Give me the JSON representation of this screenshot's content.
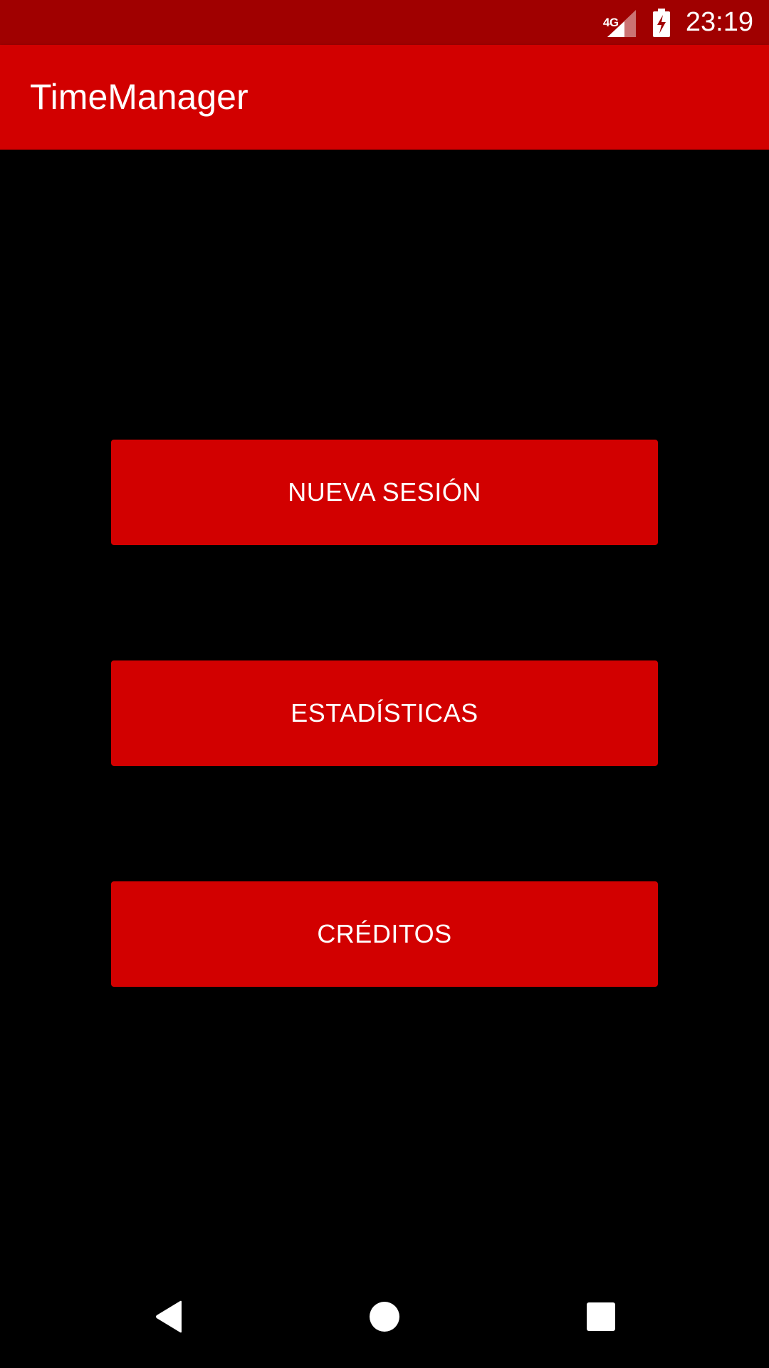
{
  "status_bar": {
    "network": "4G",
    "time": "23:19",
    "signal_icon": "signal-icon",
    "battery_icon": "battery-charging-icon"
  },
  "app_bar": {
    "title": "TimeManager"
  },
  "menu": {
    "buttons": [
      {
        "label": "NUEVA SESIÓN"
      },
      {
        "label": "ESTADÍSTICAS"
      },
      {
        "label": "CRÉDITOS"
      }
    ]
  },
  "nav_bar": {
    "back_icon": "back-icon",
    "home_icon": "home-icon",
    "recents_icon": "recents-icon"
  },
  "colors": {
    "status_bar": "#a00000",
    "primary": "#d20000",
    "background": "#000000",
    "text": "#ffffff"
  }
}
